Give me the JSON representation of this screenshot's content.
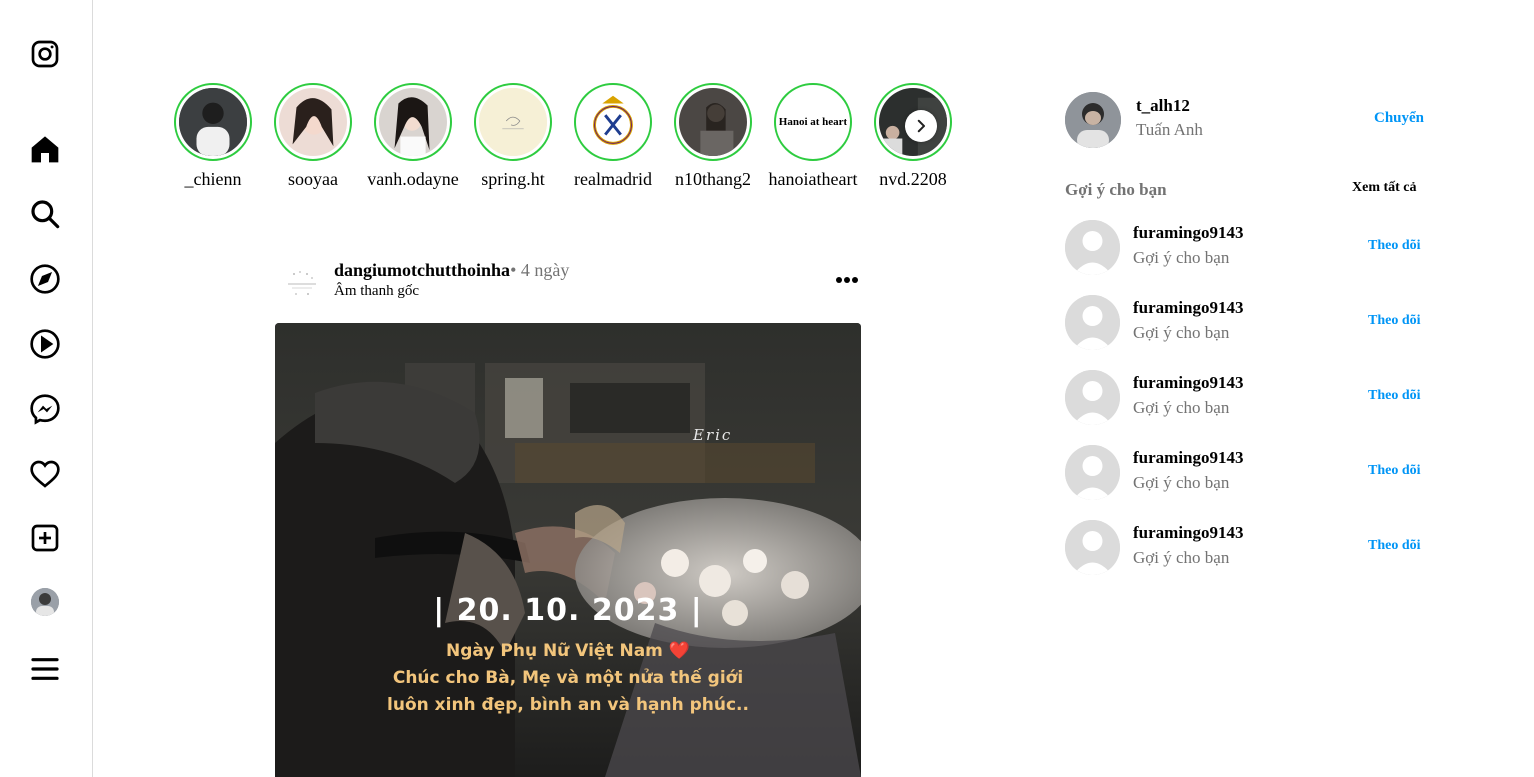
{
  "app": {
    "name": "Instagram"
  },
  "sidebar": {
    "items": [
      {
        "icon": "instagram-logo-icon"
      },
      {
        "icon": "home-icon"
      },
      {
        "icon": "search-icon"
      },
      {
        "icon": "explore-compass-icon"
      },
      {
        "icon": "reels-play-icon"
      },
      {
        "icon": "messenger-icon"
      },
      {
        "icon": "heart-notifications-icon"
      },
      {
        "icon": "create-plus-icon"
      },
      {
        "icon": "profile-avatar"
      },
      {
        "icon": "menu-hamburger-icon"
      }
    ]
  },
  "stories": [
    {
      "username": "_chienn"
    },
    {
      "username": "sooyaa"
    },
    {
      "username": "vanh.odayne"
    },
    {
      "username": "spring.ht"
    },
    {
      "username": "realmadrid"
    },
    {
      "username": "n10thang2"
    },
    {
      "username": "hanoiatheart",
      "avatar_text": "Hanoi at heart"
    },
    {
      "username": "nvd.2208"
    }
  ],
  "post": {
    "username": "dangiumotchutthoinha",
    "time": "• 4 ngày",
    "audio": "Âm thanh gốc",
    "avatar_text": "DANGIUMOTCHUTTHOINHA",
    "overlay": {
      "signature": "Eric",
      "date": "| 20. 10. 2023 |",
      "line1": "Ngày Phụ Nữ Việt Nam ❤️",
      "line2": "Chúc cho Bà, Mẹ và một nửa thế giới",
      "line3": "luôn xinh đẹp, bình an và hạnh phúc.."
    }
  },
  "current_user": {
    "username": "t_alh12",
    "full_name": "Tuấn Anh",
    "switch_label": "Chuyển"
  },
  "suggestions": {
    "title": "Gợi ý cho bạn",
    "see_all": "Xem tất cả",
    "items": [
      {
        "username": "furamingo9143",
        "subtitle": "Gợi ý cho bạn",
        "follow": "Theo dõi"
      },
      {
        "username": "furamingo9143",
        "subtitle": "Gợi ý cho bạn",
        "follow": "Theo dõi"
      },
      {
        "username": "furamingo9143",
        "subtitle": "Gợi ý cho bạn",
        "follow": "Theo dõi"
      },
      {
        "username": "furamingo9143",
        "subtitle": "Gợi ý cho bạn",
        "follow": "Theo dõi"
      },
      {
        "username": "furamingo9143",
        "subtitle": "Gợi ý cho bạn",
        "follow": "Theo dõi"
      }
    ]
  },
  "colors": {
    "accent": "#0095f6",
    "story_ring": "#2ecc40",
    "muted": "#737373"
  }
}
